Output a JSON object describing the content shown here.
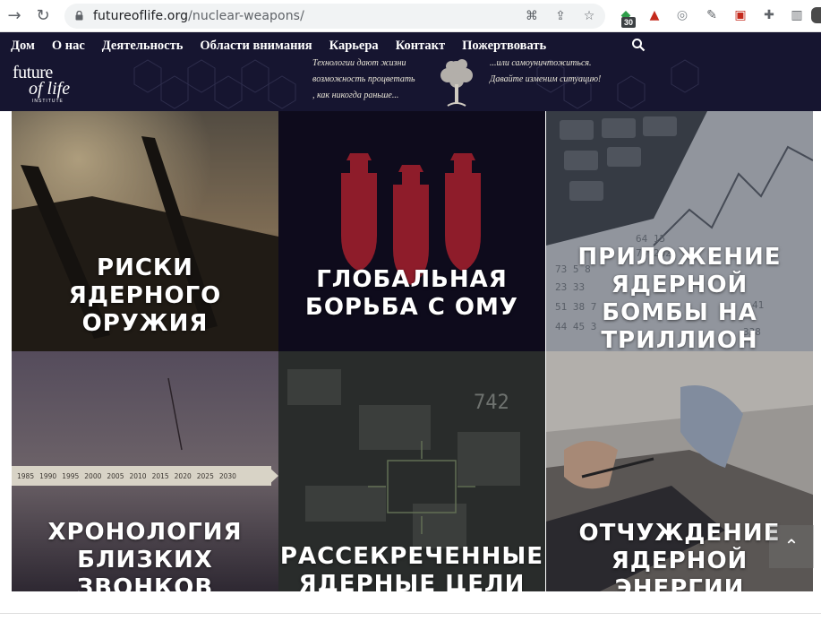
{
  "browser": {
    "url_domain": "futureoflife.org",
    "url_path": "/nuclear-weapons/",
    "extension_badge": "30"
  },
  "header": {
    "menu": [
      "Дом",
      "О нас",
      "Деятельность",
      "Области внимания",
      "Карьера",
      "Контакт",
      "Пожертвовать"
    ],
    "logo": {
      "line1": "future",
      "line2": "of life",
      "line3": "INSTITUTE"
    },
    "tagline_left": [
      "Технологии дают жизни",
      "возможность процветать",
      ", как никогда раньше..."
    ],
    "tagline_right": [
      "...или самоуничтожиться.",
      "Давайте изменим ситуацию!"
    ]
  },
  "tiles": [
    {
      "title": [
        "РИСКИ",
        "ЯДЕРНОГО",
        "ОРУЖИЯ"
      ]
    },
    {
      "title": [
        "ГЛОБАЛЬНАЯ",
        "БОРЬБА С ОМУ"
      ]
    },
    {
      "title": [
        "ПРИЛОЖЕНИЕ",
        "ЯДЕРНОЙ",
        "БОМБЫ НА",
        "ТРИЛЛИОН"
      ]
    },
    {
      "title": [
        "ХРОНОЛОГИЯ",
        "БЛИЗКИХ",
        "ЗВОНКОВ"
      ],
      "timeline_years": [
        "1985",
        "1990",
        "1995",
        "2000",
        "2005",
        "2010",
        "2015",
        "2020",
        "2025",
        "2030"
      ]
    },
    {
      "title": [
        "РАССЕКРЕЧЕННЫЕ",
        "ЯДЕРНЫЕ ЦЕЛИ"
      ],
      "overlay_digits": "742"
    },
    {
      "title": [
        "ОТЧУЖДЕНИЕ",
        "ЯДЕРНОЙ",
        "ЭНЕРГИИ"
      ]
    }
  ],
  "colors": {
    "header_bg": "#161530",
    "bomb_red": "#8e1c2a",
    "tile2_bg": "#0e0b1c"
  }
}
